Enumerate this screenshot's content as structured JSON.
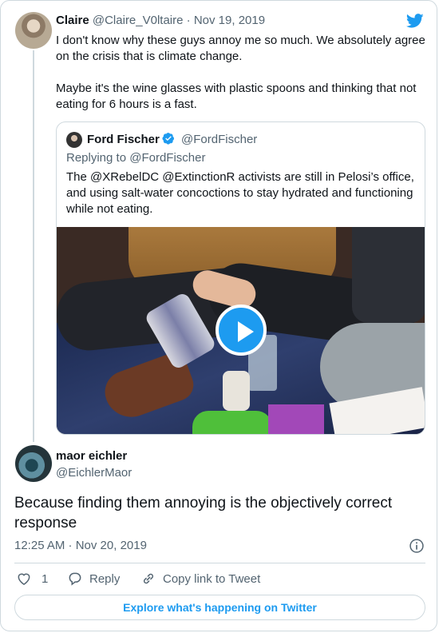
{
  "claire": {
    "name": "Claire",
    "handle": "@Claire_V0ltaire",
    "separator": "·",
    "date": "Nov 19, 2019",
    "text_p1": "I don't know why these guys annoy me so much. We absolutely agree on the crisis that is climate change.",
    "text_p2": "Maybe it's the wine glasses with plastic spoons and thinking that not eating for 6 hours is a fast."
  },
  "quoted": {
    "name": "Ford Fischer",
    "handle": "@FordFischer",
    "replying_to": "Replying to @FordFischer",
    "text": "The @XRebelDC @ExtinctionR activists are still in Pelosi’s office, and using salt-water concoctions to stay hydrated and functioning while not eating."
  },
  "maor": {
    "name": "maor eichler",
    "handle": "@EichlerMaor",
    "text": "Because finding them annoying is the objectively correct response",
    "timestamp": "12:25 AM · Nov 20, 2019"
  },
  "actions": {
    "like_count": "1",
    "reply_label": "Reply",
    "copy_label": "Copy link to Tweet"
  },
  "explore_label": "Explore what's happening on Twitter",
  "colors": {
    "accent": "#1d9bf0",
    "muted": "#536471",
    "border": "#cfd9de"
  },
  "icons": [
    "twitter-bird-icon",
    "verified-badge-icon",
    "play-icon",
    "info-icon",
    "heart-icon",
    "reply-icon",
    "link-icon"
  ]
}
